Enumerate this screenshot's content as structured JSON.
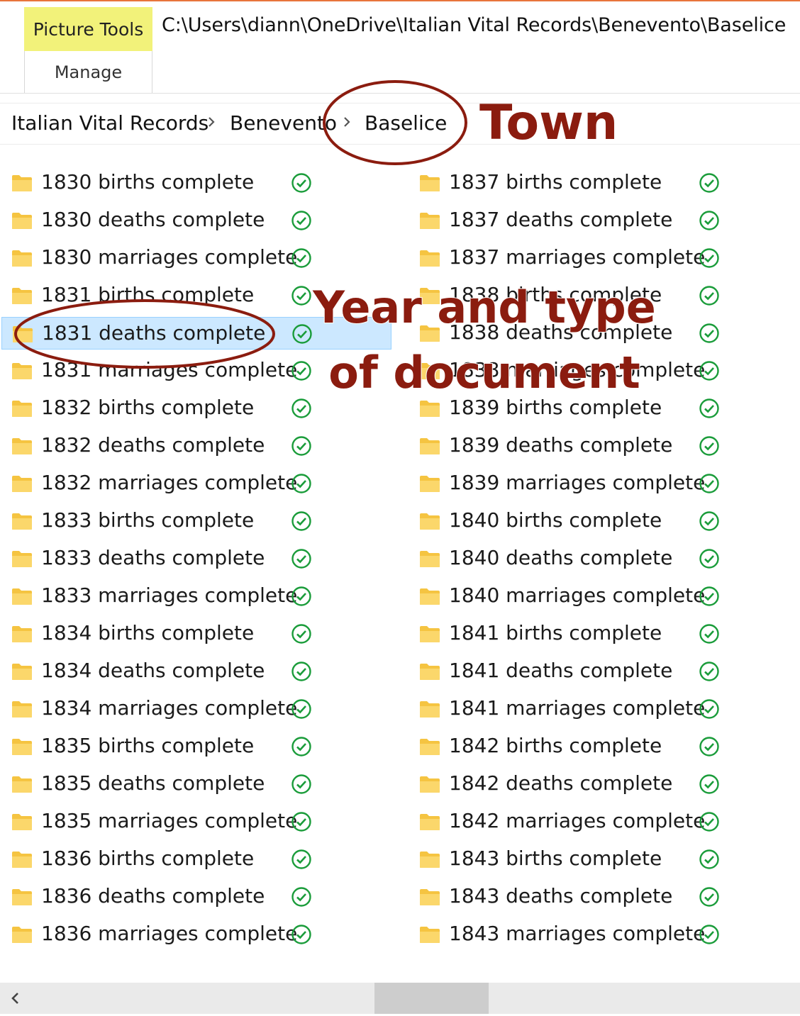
{
  "ribbon": {
    "tab_label": "Picture Tools",
    "tab_color": "#f2f27a",
    "subtab_label": "Manage",
    "path": "C:\\Users\\diann\\OneDrive\\Italian Vital Records\\Benevento\\Baselice"
  },
  "breadcrumb": {
    "items": [
      "Italian Vital Records",
      "Benevento",
      "Baselice"
    ],
    "separator_icon": "chevron-right-icon"
  },
  "annotations": {
    "town": "Town",
    "year_type_line1": "Year and type",
    "year_type_line2": "of document",
    "color": "#8b1c0f"
  },
  "files": {
    "left": [
      "1830 births complete",
      "1830 deaths complete",
      "1830 marriages complete",
      "1831 births complete",
      "1831 deaths complete",
      "1831 marriages complete",
      "1832 births complete",
      "1832 deaths complete",
      "1832 marriages complete",
      "1833 births complete",
      "1833 deaths complete",
      "1833 marriages complete",
      "1834 births complete",
      "1834 deaths complete",
      "1834 marriages complete",
      "1835 births complete",
      "1835 deaths complete",
      "1835 marriages complete",
      "1836 births complete",
      "1836 deaths complete",
      "1836 marriages complete"
    ],
    "right": [
      "1837 births complete",
      "1837 deaths complete",
      "1837 marriages complete",
      "1838 births complete",
      "1838 deaths complete",
      "1838 marriages complete",
      "1839 births complete",
      "1839 deaths complete",
      "1839 marriages complete",
      "1840 births complete",
      "1840 deaths complete",
      "1840 marriages complete",
      "1841 births complete",
      "1841 deaths complete",
      "1841 marriages complete",
      "1842 births complete",
      "1842 deaths complete",
      "1842 marriages complete",
      "1843 births complete",
      "1843 deaths complete",
      "1843 marriages complete"
    ],
    "selected": "1831 deaths complete",
    "status_icon": "sync-complete-check-icon",
    "folder_icon": "folder-icon",
    "status_color": "#1a9c3a",
    "folder_color": "#f5c441"
  },
  "scrollbar": {
    "left_icon": "chevron-left-icon"
  }
}
